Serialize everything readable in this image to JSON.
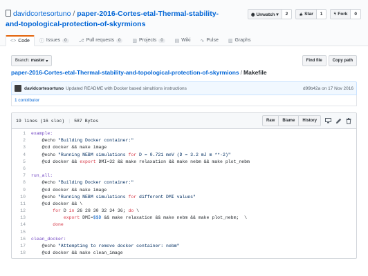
{
  "repo": {
    "owner": "davidcortesortuno",
    "separator": " / ",
    "name": "paper-2016-Cortes-etal-Thermal-stability-and-topological-protection-of-skyrmions"
  },
  "actions": [
    {
      "label": "Unwatch ▾",
      "icon": "eye-icon",
      "count": "2"
    },
    {
      "label": "Star",
      "icon": "star-icon",
      "count": "1"
    },
    {
      "label": "Fork",
      "icon": "fork-icon",
      "count": "0"
    }
  ],
  "tabs": [
    {
      "label": "Code",
      "icon": "<>",
      "count": "",
      "active": true
    },
    {
      "label": "Issues",
      "icon": "ⓘ",
      "count": "0",
      "active": false
    },
    {
      "label": "Pull requests",
      "icon": "⎇",
      "count": "0",
      "active": false
    },
    {
      "label": "Projects",
      "icon": "▥",
      "count": "0",
      "active": false
    },
    {
      "label": "Wiki",
      "icon": "▤",
      "count": "",
      "active": false
    },
    {
      "label": "Pulse",
      "icon": "∿",
      "count": "",
      "active": false
    },
    {
      "label": "Graphs",
      "icon": "▥",
      "count": "",
      "active": false
    }
  ],
  "branch": {
    "prefix": "Branch:",
    "name": "master"
  },
  "file_buttons": {
    "find": "Find file",
    "copy": "Copy path"
  },
  "breadcrumb": {
    "repo": "paper-2016-Cortes-etal-Thermal-stability-and-topological-protection-of-skyrmions",
    "sep": "/",
    "file": "Makefile"
  },
  "commit": {
    "author": "davidcortesortuno",
    "message": "Updated README with Docker based simultions instructions",
    "sha": "d99b42a",
    "date_text": "on 17 Nov 2016"
  },
  "contributors": "1 contributor",
  "file_info": {
    "lines": "19 lines (16 sloc)",
    "size": "587 Bytes"
  },
  "file_actions": {
    "raw": "Raw",
    "blame": "Blame",
    "history": "History"
  },
  "code": [
    {
      "n": "1",
      "t": "example:"
    },
    {
      "n": "2",
      "t": "\t@echo \"Building Docker container:\""
    },
    {
      "n": "3",
      "t": "\t@cd docker && make image"
    },
    {
      "n": "4",
      "t": "\t@echo \"Running NEBM simulations for D = 0.721 meV (D = 3.2 mJ m **-2)\""
    },
    {
      "n": "5",
      "t": "\t@cd docker && export DMI=32 && make relaxation && make nebm && make plot_nebm"
    },
    {
      "n": "6",
      "t": ""
    },
    {
      "n": "7",
      "t": "run_all:"
    },
    {
      "n": "8",
      "t": "\t@echo \"Building Docker container:\""
    },
    {
      "n": "9",
      "t": "\t@cd docker && make image"
    },
    {
      "n": "10",
      "t": "\t@echo \"Running NEBM simulations for different DMI values\""
    },
    {
      "n": "11",
      "t": "\t@cd docker && \\"
    },
    {
      "n": "12",
      "t": "\t\tfor D in 26 28 30 32 34 36; do \\"
    },
    {
      "n": "13",
      "t": "\t\t\texport DMI=$$D && make relaxation && make nebm && make plot_nebm;  \\"
    },
    {
      "n": "14",
      "t": "\t\tdone"
    },
    {
      "n": "15",
      "t": ""
    },
    {
      "n": "16",
      "t": "clean_docker:"
    },
    {
      "n": "17",
      "t": "\t@echo \"Attempting to remove docker container: nebm\""
    },
    {
      "n": "18",
      "t": "\t@cd docker && make clean_image"
    }
  ]
}
